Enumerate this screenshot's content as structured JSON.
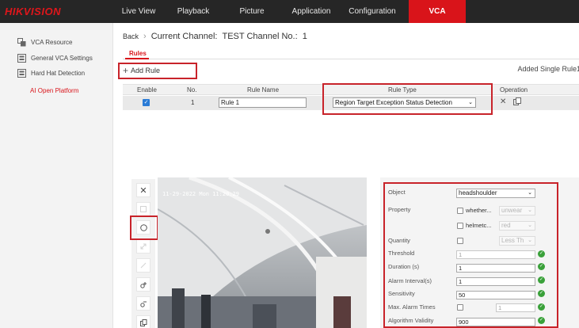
{
  "brand": "HIKVISION",
  "nav": {
    "items": [
      {
        "label": "Live View"
      },
      {
        "label": "Playback"
      },
      {
        "label": "Picture"
      },
      {
        "label": "Application"
      },
      {
        "label": "Configuration"
      },
      {
        "label": "VCA",
        "active": true
      }
    ]
  },
  "sidebar": {
    "items": [
      {
        "label": "VCA Resource",
        "icon": "vca-resource-icon"
      },
      {
        "label": "General VCA Settings",
        "icon": "general-settings-icon"
      },
      {
        "label": "Hard Hat Detection",
        "icon": "hard-hat-icon"
      },
      {
        "label": "AI Open Platform",
        "active": true
      }
    ]
  },
  "breadcrumb": {
    "back": "Back",
    "current_label": "Current Channel:",
    "current_value": "TEST Channel No.:  1"
  },
  "tabs": {
    "rules": "Rules"
  },
  "toolbar": {
    "add_rule": "Add Rule",
    "added_single": "Added Single Rule1"
  },
  "table": {
    "headers": {
      "enable": "Enable",
      "no": "No.",
      "rule_name": "Rule Name",
      "rule_type": "Rule Type",
      "operation": "Operation"
    },
    "row": {
      "enabled": true,
      "no": "1",
      "rule_name": "Rule 1",
      "rule_type": "Region Target Exception Status Detection"
    }
  },
  "video": {
    "osd": "11-29-2022 Mon 11:20:29"
  },
  "properties": {
    "object": {
      "label": "Object",
      "value": "headshoulder"
    },
    "property": {
      "label": "Property",
      "whether": "whether...",
      "whether_value": "unwear",
      "helmet": "helmetc...",
      "helmet_value": "red"
    },
    "quantity": {
      "label": "Quantity",
      "value": "Less Th"
    },
    "threshold": {
      "label": "Threshold",
      "value": "1"
    },
    "duration": {
      "label": "Duration (s)",
      "value": "1"
    },
    "alarm_interval": {
      "label": "Alarm Interval(s)",
      "value": "1"
    },
    "sensitivity": {
      "label": "Sensitivity",
      "value": "50"
    },
    "max_alarm_times": {
      "label": "Max. Alarm Times",
      "value": "1"
    },
    "algorithm_validity": {
      "label": "Algorithm Validity",
      "value": "900"
    }
  },
  "colors": {
    "accent": "#d9141a",
    "topbar": "#262626",
    "highlight_box": "#c8232a",
    "ok_green": "#3aa13a"
  }
}
